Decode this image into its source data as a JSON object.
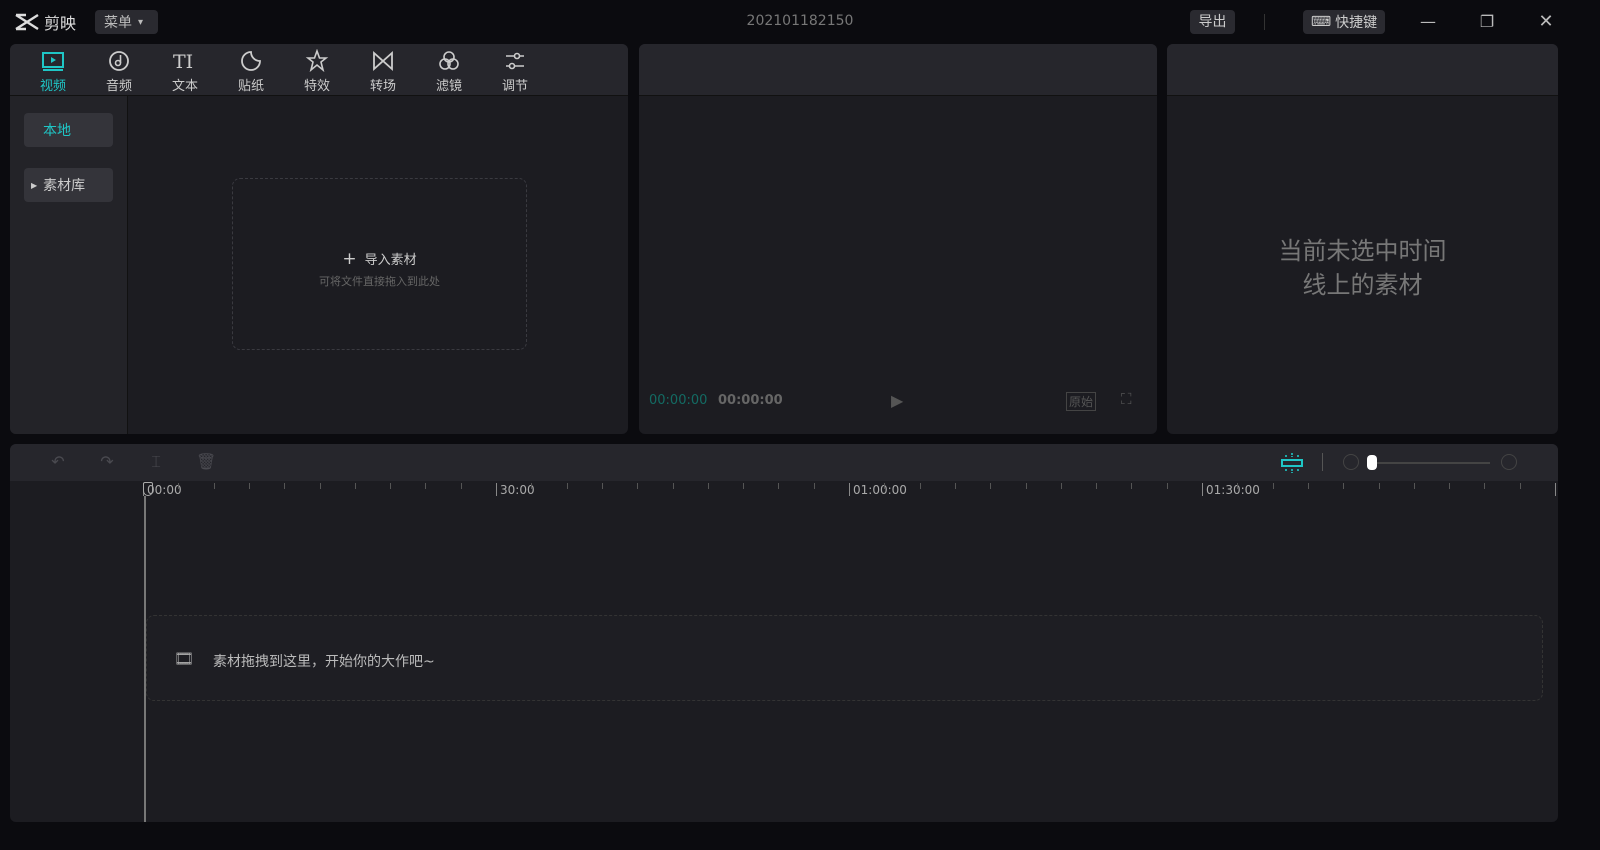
{
  "app": {
    "name": "剪映",
    "menu_label": "菜单",
    "title": "202101182150",
    "export_label": "导出",
    "shortcut_label": "快捷键"
  },
  "tabs": [
    {
      "label": "视频",
      "icon": "video-icon"
    },
    {
      "label": "音频",
      "icon": "audio-icon"
    },
    {
      "label": "文本",
      "icon": "text-icon"
    },
    {
      "label": "贴纸",
      "icon": "sticker-icon"
    },
    {
      "label": "特效",
      "icon": "effects-icon"
    },
    {
      "label": "转场",
      "icon": "transition-icon"
    },
    {
      "label": "滤镜",
      "icon": "filter-icon"
    },
    {
      "label": "调节",
      "icon": "adjust-icon"
    }
  ],
  "sidebar": {
    "local": "本地",
    "library": "素材库"
  },
  "media": {
    "import_label": "导入素材",
    "hint": "可将文件直接拖入到此处"
  },
  "player": {
    "current_time": "00:00:00",
    "total_time": "00:00:00",
    "original_label": "原始"
  },
  "inspector": {
    "empty_line1": "当前未选中时间",
    "empty_line2": "线上的素材"
  },
  "timeline": {
    "ruler": [
      "00:00",
      "30:00",
      "01:00:00",
      "01:30:00"
    ],
    "drop_hint": "素材拖拽到这里，开始你的大作吧~",
    "zoom_level": 0.0
  },
  "colors": {
    "accent": "#1fc6c6"
  }
}
